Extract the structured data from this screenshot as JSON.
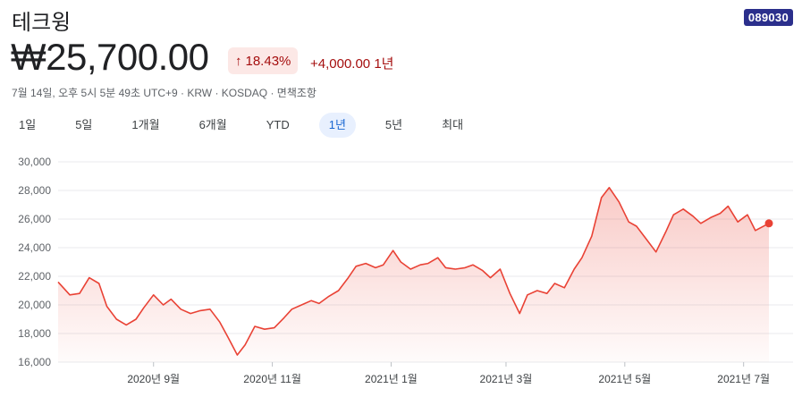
{
  "header": {
    "title": "테크윙",
    "ticker": "089030",
    "price": "₩25,700.00",
    "change_pct": "18.43%",
    "change_abs": "+4,000.00 1년",
    "meta": "7월 14일, 오후 5시 5분 49초 UTC+9 · KRW · KOSDAQ · 면책조항"
  },
  "tabs": [
    {
      "label": "1일",
      "active": false
    },
    {
      "label": "5일",
      "active": false
    },
    {
      "label": "1개월",
      "active": false
    },
    {
      "label": "6개월",
      "active": false
    },
    {
      "label": "YTD",
      "active": false
    },
    {
      "label": "1년",
      "active": true
    },
    {
      "label": "5년",
      "active": false
    },
    {
      "label": "최대",
      "active": false
    }
  ],
  "colors": {
    "line": "#e94235",
    "up": "#a50e0e",
    "badge": "#2b2f8c",
    "active_tab": "#1967d2"
  },
  "icons": {
    "change_arrow": "arrow-up-icon"
  },
  "chart_data": {
    "type": "area",
    "title": "",
    "xlabel": "",
    "ylabel": "",
    "ylim": [
      16000,
      30000
    ],
    "yticks": [
      16000,
      18000,
      20000,
      22000,
      24000,
      26000,
      28000,
      30000
    ],
    "ytick_labels": [
      "16,000",
      "18,000",
      "20,000",
      "22,000",
      "24,000",
      "26,000",
      "28,000",
      "30,000"
    ],
    "xlim": [
      "2020-07-14",
      "2021-07-14"
    ],
    "xticks": [
      {
        "date": "2020-09-01",
        "label": "2020년 9월"
      },
      {
        "date": "2020-11-01",
        "label": "2020년 11월"
      },
      {
        "date": "2021-01-01",
        "label": "2021년 1월"
      },
      {
        "date": "2021-03-01",
        "label": "2021년 3월"
      },
      {
        "date": "2021-05-01",
        "label": "2021년 5월"
      },
      {
        "date": "2021-07-01",
        "label": "2021년 7월"
      }
    ],
    "grid": true,
    "legend": "none",
    "series": [
      {
        "x": [
          "2020-07-14",
          "2020-07-20",
          "2020-07-25",
          "2020-07-30",
          "2020-08-04",
          "2020-08-08",
          "2020-08-13",
          "2020-08-18",
          "2020-08-23",
          "2020-08-27",
          "2020-09-01",
          "2020-09-06",
          "2020-09-10",
          "2020-09-15",
          "2020-09-20",
          "2020-09-25",
          "2020-09-30",
          "2020-10-05",
          "2020-10-09",
          "2020-10-14",
          "2020-10-18",
          "2020-10-23",
          "2020-10-28",
          "2020-11-02",
          "2020-11-07",
          "2020-11-11",
          "2020-11-16",
          "2020-11-21",
          "2020-11-25",
          "2020-11-30",
          "2020-12-05",
          "2020-12-10",
          "2020-12-14",
          "2020-12-19",
          "2020-12-24",
          "2020-12-28",
          "2021-01-02",
          "2021-01-06",
          "2021-01-11",
          "2021-01-16",
          "2021-01-20",
          "2021-01-25",
          "2021-01-29",
          "2021-02-03",
          "2021-02-08",
          "2021-02-12",
          "2021-02-17",
          "2021-02-21",
          "2021-02-26",
          "2021-03-03",
          "2021-03-08",
          "2021-03-12",
          "2021-03-17",
          "2021-03-22",
          "2021-03-26",
          "2021-03-31",
          "2021-04-05",
          "2021-04-09",
          "2021-04-14",
          "2021-04-19",
          "2021-04-23",
          "2021-04-28",
          "2021-05-03",
          "2021-05-07",
          "2021-05-12",
          "2021-05-17",
          "2021-05-22",
          "2021-05-26",
          "2021-05-31",
          "2021-06-05",
          "2021-06-09",
          "2021-06-14",
          "2021-06-19",
          "2021-06-23",
          "2021-06-28",
          "2021-07-03",
          "2021-07-07",
          "2021-07-14"
        ],
        "values": [
          21600,
          20700,
          20800,
          21900,
          21500,
          19900,
          19000,
          18600,
          19000,
          19800,
          20700,
          20000,
          20400,
          19700,
          19400,
          19600,
          19700,
          18800,
          17800,
          16500,
          17200,
          18500,
          18300,
          18400,
          19100,
          19700,
          20000,
          20300,
          20100,
          20600,
          21000,
          21900,
          22700,
          22900,
          22600,
          22800,
          23800,
          23000,
          22500,
          22800,
          22900,
          23300,
          22600,
          22500,
          22600,
          22800,
          22400,
          21900,
          22500,
          20800,
          19400,
          20700,
          21000,
          20800,
          21500,
          21200,
          22500,
          23300,
          24800,
          27500,
          28200,
          27200,
          25800,
          25500,
          24600,
          23700,
          25100,
          26300,
          26700,
          26200,
          25700,
          26100,
          26400,
          26900,
          25800,
          26300,
          25200,
          25700
        ]
      }
    ]
  }
}
